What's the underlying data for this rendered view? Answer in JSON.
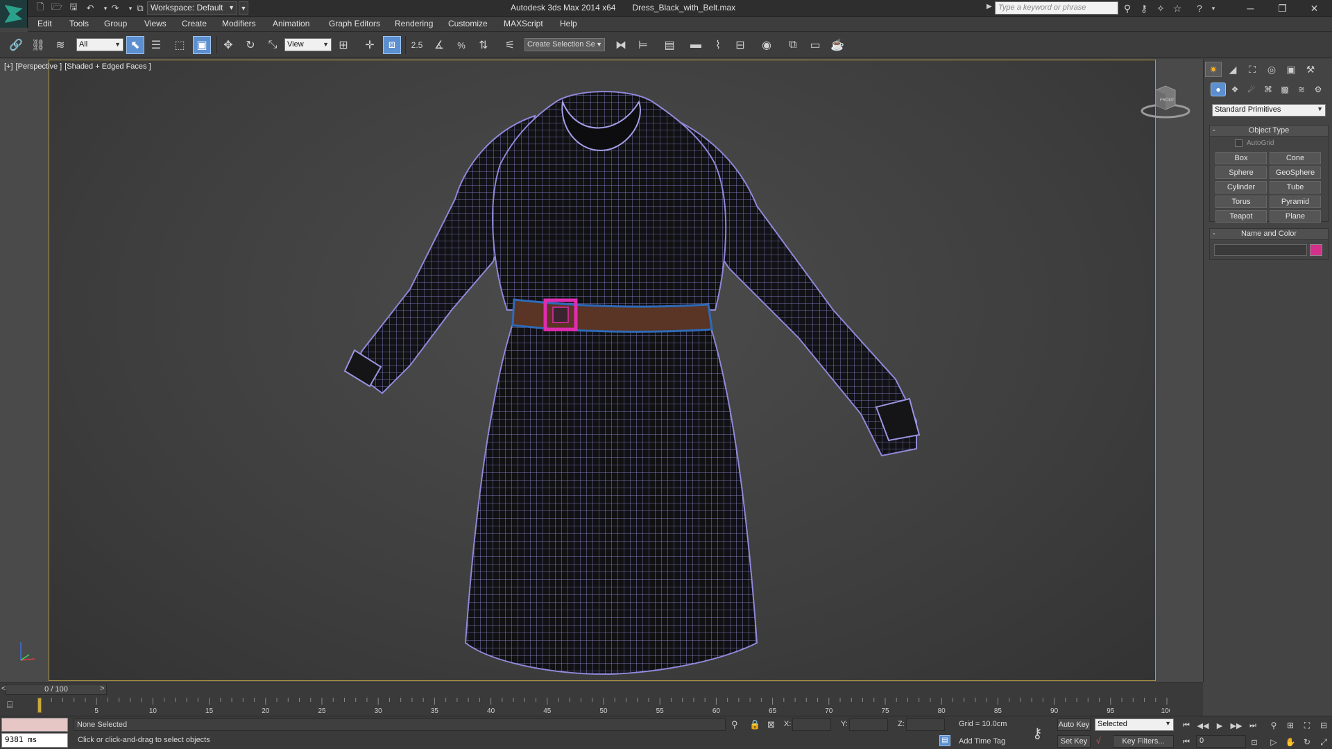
{
  "titlebar": {
    "workspace": "Workspace: Default",
    "app_name": "Autodesk 3ds Max  2014 x64",
    "file_name": "Dress_Black_with_Belt.max",
    "search_placeholder": "Type a keyword or phrase"
  },
  "menu": [
    "Edit",
    "Tools",
    "Group",
    "Views",
    "Create",
    "Modifiers",
    "Animation",
    "Graph Editors",
    "Rendering",
    "Customize",
    "MAXScript",
    "Help"
  ],
  "toolbar": {
    "selection_filter": "All",
    "reference_coord": "View",
    "snap_label": "2.5",
    "named_selection_placeholder": "Create Selection Se"
  },
  "viewport": {
    "label_plus": "[+]",
    "label_view": "[Perspective ]",
    "label_shading": "[Shaded + Edged Faces ]",
    "viewcube_label": "FRONT",
    "wire_color": "#8f88d8",
    "buckle_color": "#e02cb0",
    "belt_color": "#2f6ab8"
  },
  "command_panel": {
    "primitive_type": "Standard Primitives",
    "object_type_title": "Object Type",
    "autogrid_label": "AutoGrid",
    "buttons": [
      "Box",
      "Cone",
      "Sphere",
      "GeoSphere",
      "Cylinder",
      "Tube",
      "Torus",
      "Pyramid",
      "Teapot",
      "Plane"
    ],
    "name_color_title": "Name and Color",
    "object_color": "#d42f8a"
  },
  "timeline": {
    "frame_display": "0 / 100",
    "ticks": [
      "5",
      "10",
      "15",
      "20",
      "25",
      "30",
      "35",
      "40",
      "45",
      "50",
      "55",
      "60",
      "65",
      "70",
      "75",
      "80",
      "85",
      "90",
      "95",
      "100"
    ]
  },
  "status": {
    "maxscript_output": "9381 ms",
    "selection": "None Selected",
    "prompt": "Click or click-and-drag to select objects",
    "x_label": "X:",
    "y_label": "Y:",
    "z_label": "Z:",
    "grid": "Grid = 10.0cm",
    "add_time_tag": "Add Time Tag",
    "auto_key": "Auto Key",
    "set_key": "Set Key",
    "key_mode": "Selected",
    "key_filters": "Key Filters...",
    "current_frame": "0"
  }
}
